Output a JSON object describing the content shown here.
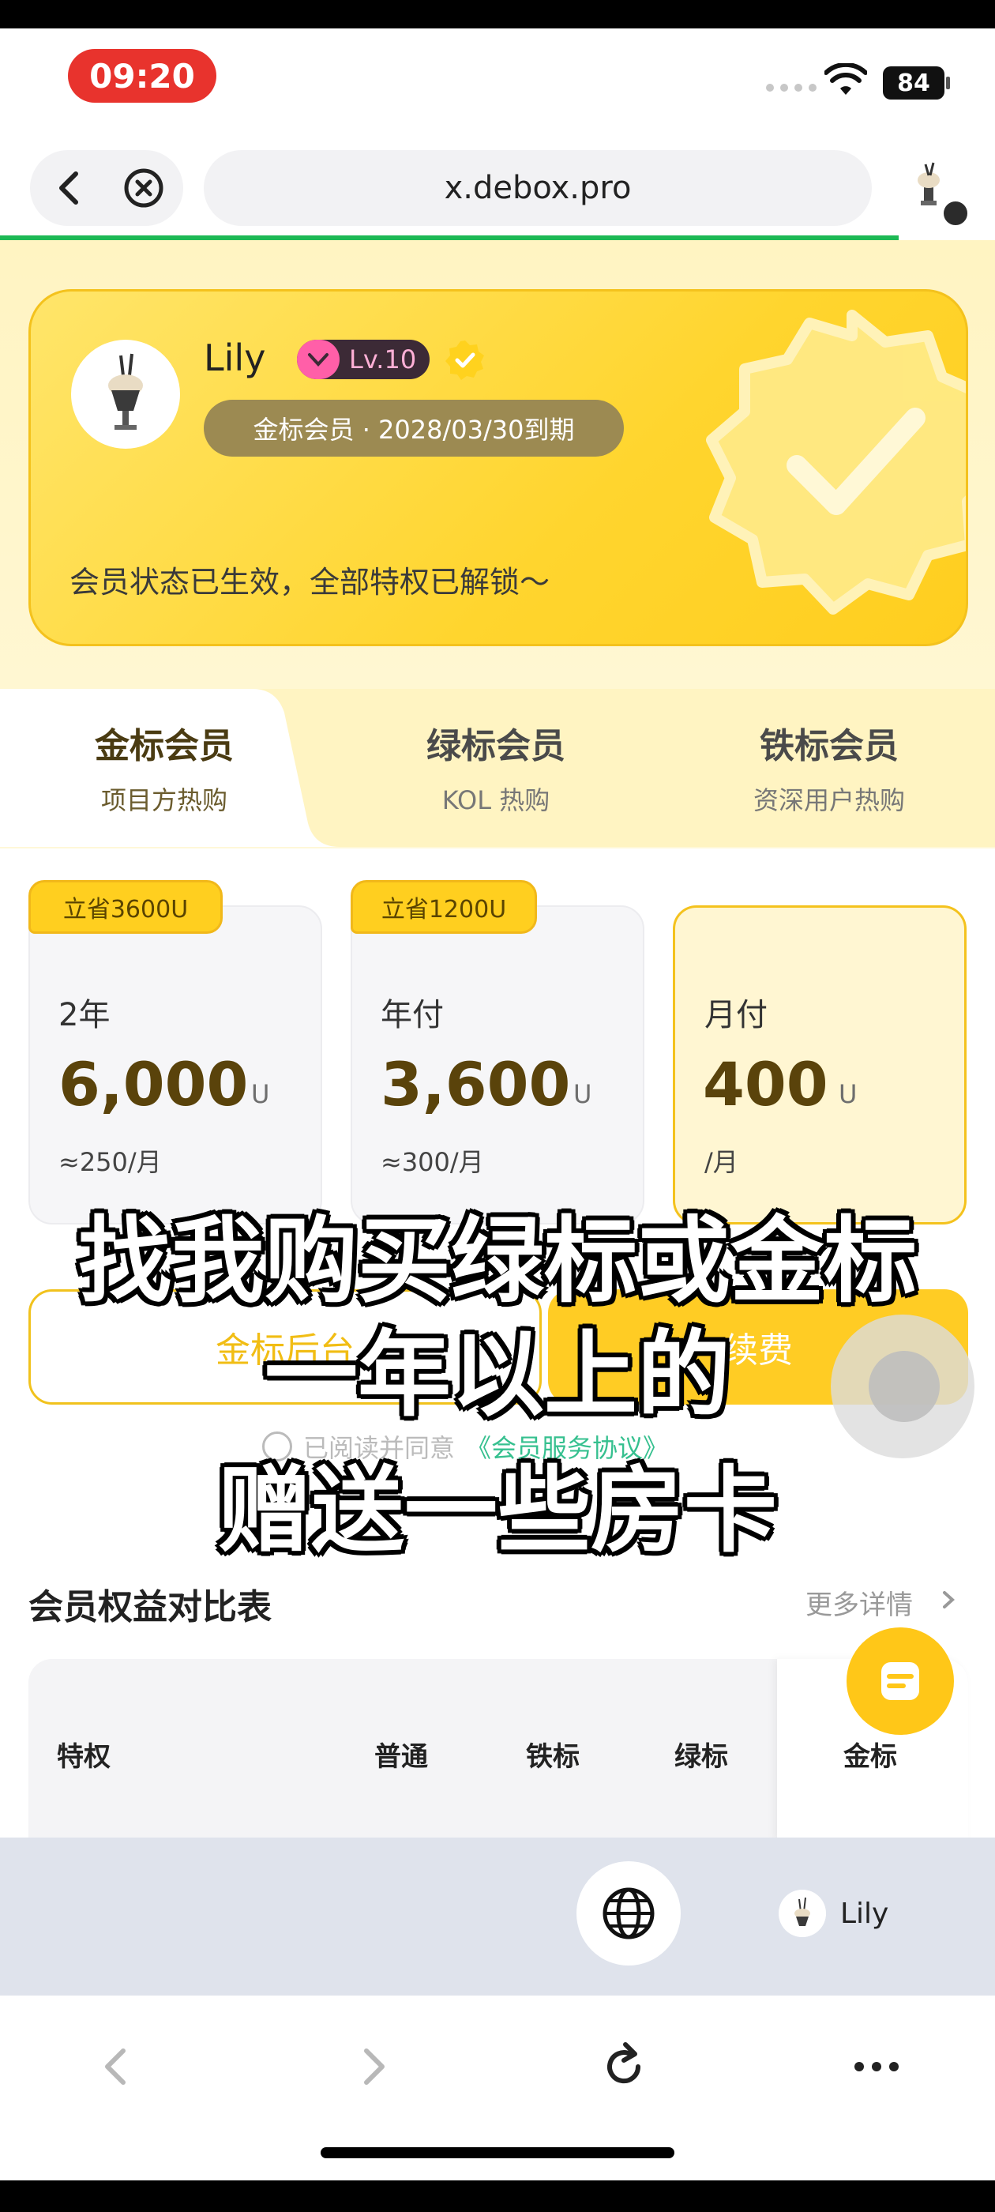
{
  "status_bar": {
    "time": "09:20",
    "battery": "84"
  },
  "browser": {
    "url": "x.debox.pro"
  },
  "profile": {
    "name": "Lily",
    "level": "Lv.10",
    "expire_text": "金标会员 · 2028/03/30到期",
    "status_message": "会员状态已生效，全部特权已解锁～"
  },
  "tabs": [
    {
      "title": "金标会员",
      "subtitle": "项目方热购"
    },
    {
      "title": "绿标会员",
      "subtitle": "KOL 热购"
    },
    {
      "title": "铁标会员",
      "subtitle": "资深用户热购"
    }
  ],
  "plans": [
    {
      "tag": "立省3600U",
      "label": "2年",
      "price": "6,000",
      "unit": "U",
      "per": "≈250/月"
    },
    {
      "tag": "立省1200U",
      "label": "年付",
      "price": "3,600",
      "unit": "U",
      "per": "≈300/月"
    },
    {
      "tag": "",
      "label": "月付",
      "price": "400",
      "unit": "U",
      "per": "/月"
    }
  ],
  "actions": {
    "backend_button": "金标后台",
    "renew_button": "续费"
  },
  "agreement": {
    "prefix": "已阅读并同意",
    "link": "《会员服务协议》"
  },
  "overlay_text": {
    "line1": "找我购买绿标或金标",
    "line2": "一年以上的",
    "line3": "赠送一些房卡"
  },
  "comparison": {
    "title": "会员权益对比表",
    "more": "更多详情",
    "headers": [
      "特权",
      "普通",
      "铁标",
      "绿标",
      "金标"
    ]
  },
  "floating_bar": {
    "user_name": "Lily"
  },
  "icons": [
    "back-icon",
    "close-circle-icon",
    "wifi-icon",
    "verified-icon",
    "globe-icon",
    "chat-icon",
    "forward-icon",
    "reload-icon",
    "more-icon"
  ],
  "colors": {
    "accent_gold": "#ffcc24",
    "progress_green": "#1db954",
    "link_green": "#36c08f"
  }
}
